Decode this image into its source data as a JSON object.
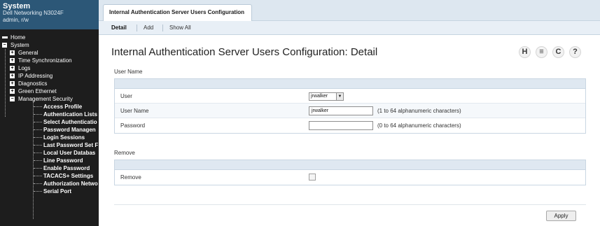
{
  "sidebar": {
    "system_title": "System",
    "device": "Dell Networking N3024F",
    "user": "admin, r/w",
    "nav": {
      "home": "Home",
      "system": "System",
      "general": "General",
      "time_sync": "Time Synchronization",
      "logs": "Logs",
      "ip_addressing": "IP Addressing",
      "diagnostics": "Diagnostics",
      "green_ethernet": "Green Ethernet",
      "management_security": "Management Security",
      "leaves": [
        "Access Profile",
        "Authentication Lists",
        "Select Authenticatio",
        "Password Managen",
        "Login Sessions",
        "Last Password Set F",
        "Local User Databas",
        "Line Password",
        "Enable Password",
        "TACACS+ Settings",
        "Authorization Netwo",
        "Serial Port"
      ]
    }
  },
  "tab": {
    "title": "Internal Authentication Server Users Configuration"
  },
  "subnav": {
    "detail": "Detail",
    "add": "Add",
    "show_all": "Show All"
  },
  "page": {
    "title": "Internal Authentication Server Users Configuration: Detail"
  },
  "toolbar": {
    "icons": [
      "help-save-icon",
      "print-icon",
      "refresh-icon",
      "help-icon"
    ],
    "save_glyph": "H",
    "print_glyph": "≡",
    "refresh_glyph": "C",
    "help_glyph": "?"
  },
  "user_section": {
    "heading": "User Name",
    "user_label": "User",
    "user_value": "jrwalker",
    "username_label": "User Name",
    "username_value": "jrwalker",
    "username_hint": "(1 to 64 alphanumeric characters)",
    "password_label": "Password",
    "password_value": "",
    "password_hint": "(0 to 64 alphanumeric characters)"
  },
  "remove_section": {
    "heading": "Remove",
    "remove_label": "Remove",
    "remove_checked": false
  },
  "actions": {
    "apply": "Apply"
  }
}
